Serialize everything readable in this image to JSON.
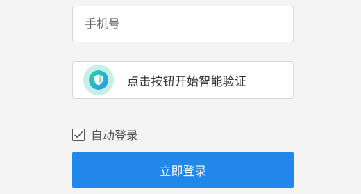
{
  "phone": {
    "value": "",
    "placeholder": "手机号"
  },
  "verify": {
    "label": "点击按钮开始智能验证",
    "icon": "shield-icon"
  },
  "auto_login": {
    "label": "自动登录",
    "checked": true
  },
  "login_button": {
    "label": "立即登录"
  },
  "colors": {
    "primary": "#2187e8",
    "shield_halo": "#c7efe8",
    "shield_start": "#2fd1a4",
    "shield_end": "#3a8ff0"
  }
}
